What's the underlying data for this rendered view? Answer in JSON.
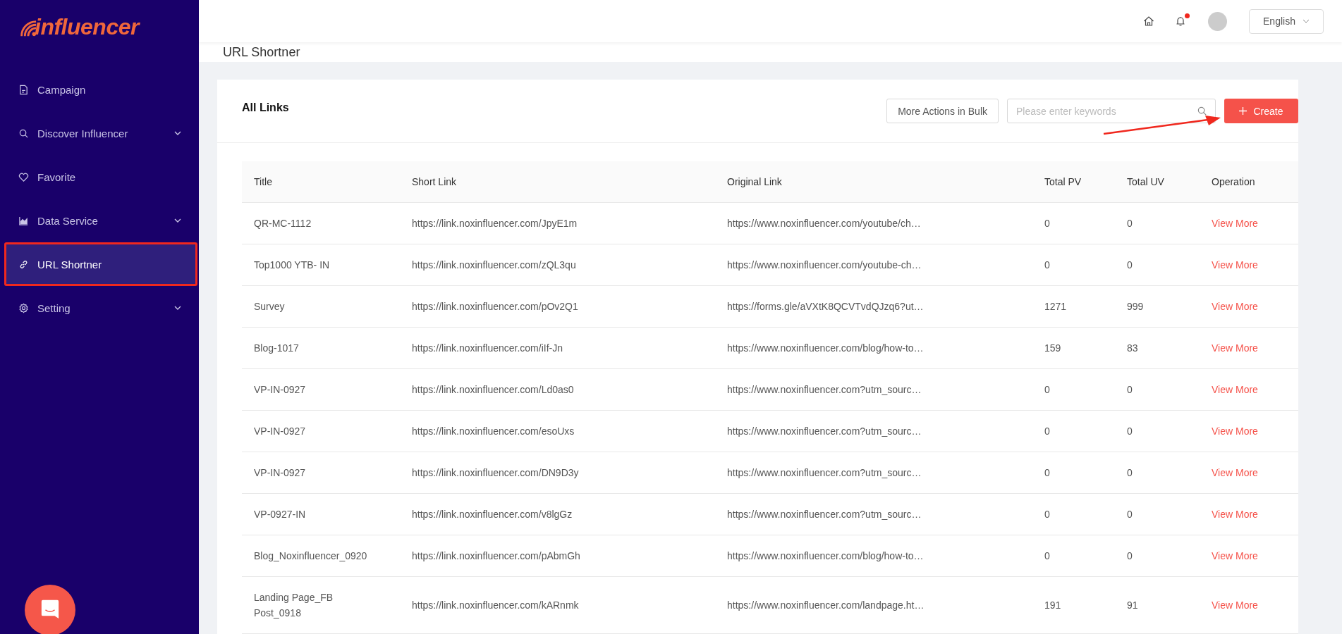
{
  "logo": {
    "text": "influencer"
  },
  "sidebar": {
    "items": [
      {
        "label": "Campaign",
        "kind": "document",
        "expandable": false,
        "selected": false
      },
      {
        "label": "Discover Influencer",
        "kind": "search",
        "expandable": true,
        "selected": false
      },
      {
        "label": "Favorite",
        "kind": "heart",
        "expandable": false,
        "selected": false
      },
      {
        "label": "Data Service",
        "kind": "chart",
        "expandable": true,
        "selected": false
      },
      {
        "label": "URL Shortner",
        "kind": "link",
        "expandable": false,
        "selected": true
      },
      {
        "label": "Setting",
        "kind": "gear",
        "expandable": true,
        "selected": false
      }
    ]
  },
  "header": {
    "notification_dot": true,
    "language": "English"
  },
  "page_title": "URL Shortner",
  "card": {
    "title": "All Links",
    "bulk_button": "More Actions in Bulk",
    "search": {
      "placeholder": "Please enter keywords"
    },
    "create_button": "Create"
  },
  "table": {
    "columns": [
      "Title",
      "Short Link",
      "Original Link",
      "Total PV",
      "Total UV",
      "Operation"
    ],
    "rows": [
      {
        "title": "QR-MC-1112",
        "short_link": "https://link.noxinfluencer.com/JpyE1m",
        "original_link": "https://www.noxinfluencer.com/youtube/ch…",
        "total_pv": "0",
        "total_uv": "0",
        "operation": "View More"
      },
      {
        "title": "Top1000 YTB- IN",
        "short_link": "https://link.noxinfluencer.com/zQL3qu",
        "original_link": "https://www.noxinfluencer.com/youtube-ch…",
        "total_pv": "0",
        "total_uv": "0",
        "operation": "View More"
      },
      {
        "title": "Survey",
        "short_link": "https://link.noxinfluencer.com/pOv2Q1",
        "original_link": "https://forms.gle/aVXtK8QCVTvdQJzq6?ut…",
        "total_pv": "1271",
        "total_uv": "999",
        "operation": "View More"
      },
      {
        "title": "Blog-1017",
        "short_link": "https://link.noxinfluencer.com/iIf-Jn",
        "original_link": "https://www.noxinfluencer.com/blog/how-to…",
        "total_pv": "159",
        "total_uv": "83",
        "operation": "View More"
      },
      {
        "title": "VP-IN-0927",
        "short_link": "https://link.noxinfluencer.com/Ld0as0",
        "original_link": "https://www.noxinfluencer.com?utm_sourc…",
        "total_pv": "0",
        "total_uv": "0",
        "operation": "View More"
      },
      {
        "title": "VP-IN-0927",
        "short_link": "https://link.noxinfluencer.com/esoUxs",
        "original_link": "https://www.noxinfluencer.com?utm_sourc…",
        "total_pv": "0",
        "total_uv": "0",
        "operation": "View More"
      },
      {
        "title": "VP-IN-0927",
        "short_link": "https://link.noxinfluencer.com/DN9D3y",
        "original_link": "https://www.noxinfluencer.com?utm_sourc…",
        "total_pv": "0",
        "total_uv": "0",
        "operation": "View More"
      },
      {
        "title": "VP-0927-IN",
        "short_link": "https://link.noxinfluencer.com/v8lgGz",
        "original_link": "https://www.noxinfluencer.com?utm_sourc…",
        "total_pv": "0",
        "total_uv": "0",
        "operation": "View More"
      },
      {
        "title": "Blog_Noxinfluencer_0920",
        "short_link": "https://link.noxinfluencer.com/pAbmGh",
        "original_link": "https://www.noxinfluencer.com/blog/how-to…",
        "total_pv": "0",
        "total_uv": "0",
        "operation": "View More"
      },
      {
        "title": "Landing Page_FB Post_0918",
        "short_link": "https://link.noxinfluencer.com/kARnmk",
        "original_link": "https://www.noxinfluencer.com/landpage.ht…",
        "total_pv": "191",
        "total_uv": "91",
        "operation": "View More"
      }
    ]
  }
}
